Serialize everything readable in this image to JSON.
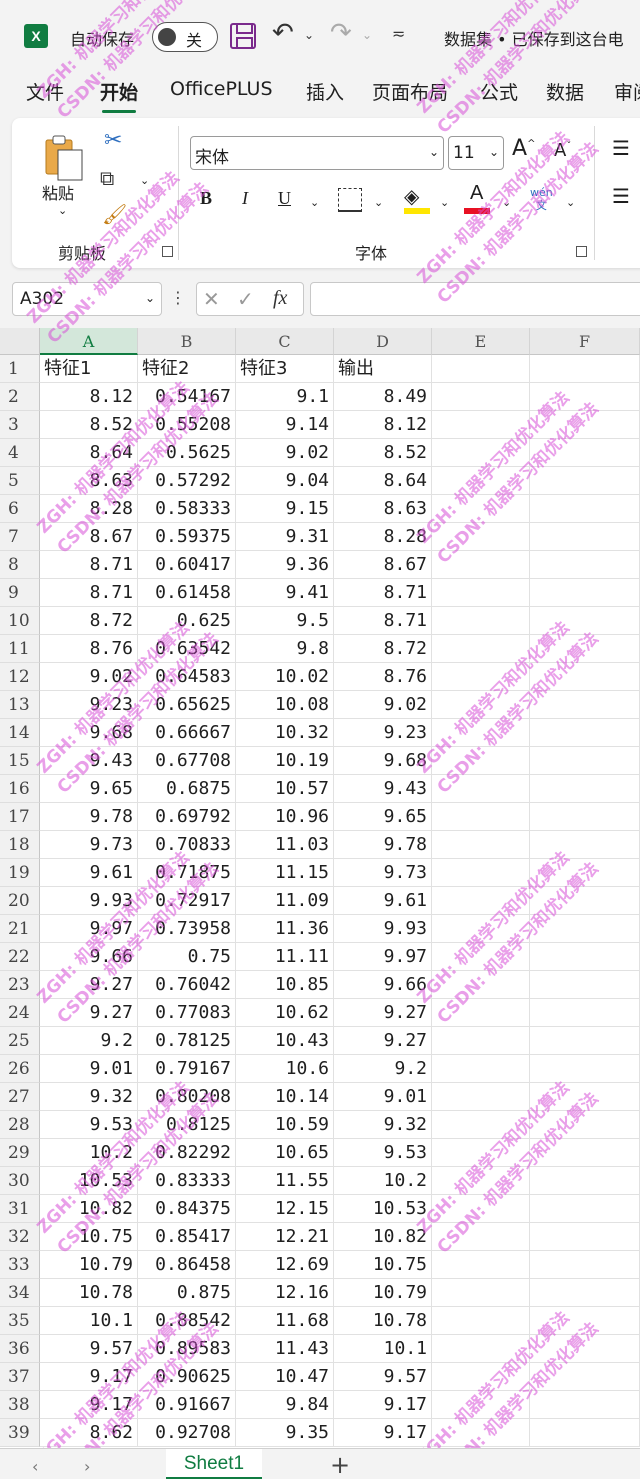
{
  "titlebar": {
    "app_icon": "X",
    "autosave_label": "自动保存",
    "autosave_state": "关",
    "doc_title": "数据集 • 已保存到这台电"
  },
  "tabs": [
    {
      "label": "文件",
      "active": false
    },
    {
      "label": "开始",
      "active": true
    },
    {
      "label": "OfficePLUS",
      "active": false
    },
    {
      "label": "插入",
      "active": false
    },
    {
      "label": "页面布局",
      "active": false
    },
    {
      "label": "公式",
      "active": false
    },
    {
      "label": "数据",
      "active": false
    },
    {
      "label": "审阅",
      "active": false
    }
  ],
  "ribbon": {
    "paste_label": "粘贴",
    "clipboard_group": "剪贴板",
    "font_group": "字体",
    "font_name": "宋体",
    "font_size": "11",
    "bold": "B",
    "italic": "I",
    "underline": "U",
    "phonetic_top": "wén",
    "phonetic_bottom": "文",
    "font_color_letter": "A",
    "fill_color": "#ffe600",
    "font_color": "#e81123"
  },
  "formula_bar": {
    "name_box": "A302",
    "fx": "fx",
    "formula": ""
  },
  "grid": {
    "columns": [
      "A",
      "B",
      "C",
      "D",
      "E",
      "F"
    ],
    "selected_column": "A",
    "header_row": [
      "特征1",
      "特征2",
      "特征3",
      "输出"
    ],
    "rows": [
      [
        "8.12",
        "0.54167",
        "9.1",
        "8.49"
      ],
      [
        "8.52",
        "0.55208",
        "9.14",
        "8.12"
      ],
      [
        "8.64",
        "0.5625",
        "9.02",
        "8.52"
      ],
      [
        "8.63",
        "0.57292",
        "9.04",
        "8.64"
      ],
      [
        "8.28",
        "0.58333",
        "9.15",
        "8.63"
      ],
      [
        "8.67",
        "0.59375",
        "9.31",
        "8.28"
      ],
      [
        "8.71",
        "0.60417",
        "9.36",
        "8.67"
      ],
      [
        "8.71",
        "0.61458",
        "9.41",
        "8.71"
      ],
      [
        "8.72",
        "0.625",
        "9.5",
        "8.71"
      ],
      [
        "8.76",
        "0.63542",
        "9.8",
        "8.72"
      ],
      [
        "9.02",
        "0.64583",
        "10.02",
        "8.76"
      ],
      [
        "9.23",
        "0.65625",
        "10.08",
        "9.02"
      ],
      [
        "9.68",
        "0.66667",
        "10.32",
        "9.23"
      ],
      [
        "9.43",
        "0.67708",
        "10.19",
        "9.68"
      ],
      [
        "9.65",
        "0.6875",
        "10.57",
        "9.43"
      ],
      [
        "9.78",
        "0.69792",
        "10.96",
        "9.65"
      ],
      [
        "9.73",
        "0.70833",
        "11.03",
        "9.78"
      ],
      [
        "9.61",
        "0.71875",
        "11.15",
        "9.73"
      ],
      [
        "9.93",
        "0.72917",
        "11.09",
        "9.61"
      ],
      [
        "9.97",
        "0.73958",
        "11.36",
        "9.93"
      ],
      [
        "9.66",
        "0.75",
        "11.11",
        "9.97"
      ],
      [
        "9.27",
        "0.76042",
        "10.85",
        "9.66"
      ],
      [
        "9.27",
        "0.77083",
        "10.62",
        "9.27"
      ],
      [
        "9.2",
        "0.78125",
        "10.43",
        "9.27"
      ],
      [
        "9.01",
        "0.79167",
        "10.6",
        "9.2"
      ],
      [
        "9.32",
        "0.80208",
        "10.14",
        "9.01"
      ],
      [
        "9.53",
        "0.8125",
        "10.59",
        "9.32"
      ],
      [
        "10.2",
        "0.82292",
        "10.65",
        "9.53"
      ],
      [
        "10.53",
        "0.83333",
        "11.55",
        "10.2"
      ],
      [
        "10.82",
        "0.84375",
        "12.15",
        "10.53"
      ],
      [
        "10.75",
        "0.85417",
        "12.21",
        "10.82"
      ],
      [
        "10.79",
        "0.86458",
        "12.69",
        "10.75"
      ],
      [
        "10.78",
        "0.875",
        "12.16",
        "10.79"
      ],
      [
        "10.1",
        "0.88542",
        "11.68",
        "10.78"
      ],
      [
        "9.57",
        "0.89583",
        "11.43",
        "10.1"
      ],
      [
        "9.17",
        "0.90625",
        "10.47",
        "9.57"
      ],
      [
        "9.17",
        "0.91667",
        "9.84",
        "9.17"
      ],
      [
        "8.62",
        "0.92708",
        "9.35",
        "9.17"
      ]
    ]
  },
  "watermark": {
    "line1": "ZGH: 机器学习和优化算法",
    "line2": "CSDN: 机器学习和优化算法"
  },
  "sheets": {
    "active": "Sheet1",
    "add": "+"
  }
}
